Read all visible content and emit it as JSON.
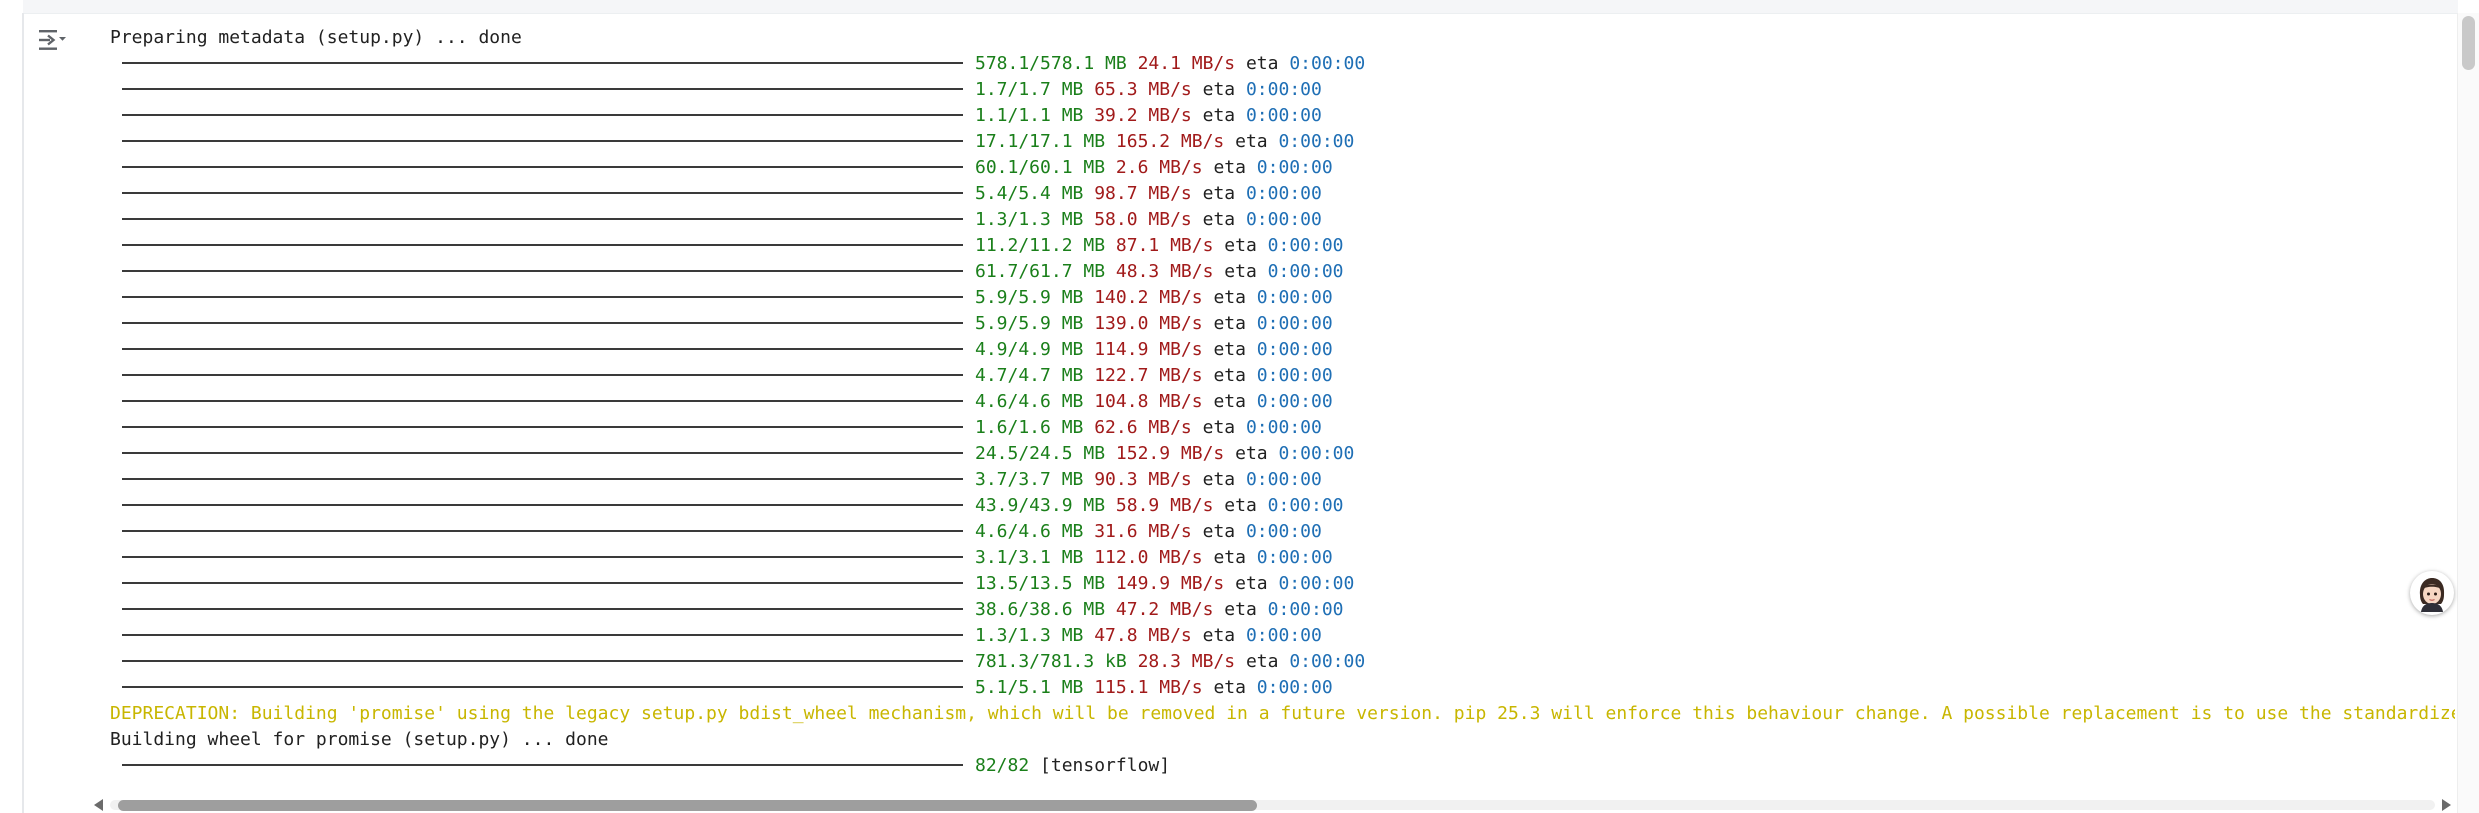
{
  "colors": {
    "progress_bar": "#3a3a3a",
    "size": "#1a7f1a",
    "speed": "#a11a1a",
    "eta": "#1f6fb5",
    "warning": "#c8b600",
    "text": "#212121"
  },
  "toolbar": {
    "output_toggle_icon": "output-toggle-icon",
    "avatar_icon": "assistant-avatar-icon"
  },
  "output": {
    "preparing_line": "Preparing metadata (setup.py) ... done",
    "downloads": [
      {
        "size": "578.1/578.1 MB",
        "speed": "24.1 MB/s",
        "eta_label": "eta",
        "eta": "0:00:00"
      },
      {
        "size": "1.7/1.7 MB",
        "speed": "65.3 MB/s",
        "eta_label": "eta",
        "eta": "0:00:00"
      },
      {
        "size": "1.1/1.1 MB",
        "speed": "39.2 MB/s",
        "eta_label": "eta",
        "eta": "0:00:00"
      },
      {
        "size": "17.1/17.1 MB",
        "speed": "165.2 MB/s",
        "eta_label": "eta",
        "eta": "0:00:00"
      },
      {
        "size": "60.1/60.1 MB",
        "speed": "2.6 MB/s",
        "eta_label": "eta",
        "eta": "0:00:00"
      },
      {
        "size": "5.4/5.4 MB",
        "speed": "98.7 MB/s",
        "eta_label": "eta",
        "eta": "0:00:00"
      },
      {
        "size": "1.3/1.3 MB",
        "speed": "58.0 MB/s",
        "eta_label": "eta",
        "eta": "0:00:00"
      },
      {
        "size": "11.2/11.2 MB",
        "speed": "87.1 MB/s",
        "eta_label": "eta",
        "eta": "0:00:00"
      },
      {
        "size": "61.7/61.7 MB",
        "speed": "48.3 MB/s",
        "eta_label": "eta",
        "eta": "0:00:00"
      },
      {
        "size": "5.9/5.9 MB",
        "speed": "140.2 MB/s",
        "eta_label": "eta",
        "eta": "0:00:00"
      },
      {
        "size": "5.9/5.9 MB",
        "speed": "139.0 MB/s",
        "eta_label": "eta",
        "eta": "0:00:00"
      },
      {
        "size": "4.9/4.9 MB",
        "speed": "114.9 MB/s",
        "eta_label": "eta",
        "eta": "0:00:00"
      },
      {
        "size": "4.7/4.7 MB",
        "speed": "122.7 MB/s",
        "eta_label": "eta",
        "eta": "0:00:00"
      },
      {
        "size": "4.6/4.6 MB",
        "speed": "104.8 MB/s",
        "eta_label": "eta",
        "eta": "0:00:00"
      },
      {
        "size": "1.6/1.6 MB",
        "speed": "62.6 MB/s",
        "eta_label": "eta",
        "eta": "0:00:00"
      },
      {
        "size": "24.5/24.5 MB",
        "speed": "152.9 MB/s",
        "eta_label": "eta",
        "eta": "0:00:00"
      },
      {
        "size": "3.7/3.7 MB",
        "speed": "90.3 MB/s",
        "eta_label": "eta",
        "eta": "0:00:00"
      },
      {
        "size": "43.9/43.9 MB",
        "speed": "58.9 MB/s",
        "eta_label": "eta",
        "eta": "0:00:00"
      },
      {
        "size": "4.6/4.6 MB",
        "speed": "31.6 MB/s",
        "eta_label": "eta",
        "eta": "0:00:00"
      },
      {
        "size": "3.1/3.1 MB",
        "speed": "112.0 MB/s",
        "eta_label": "eta",
        "eta": "0:00:00"
      },
      {
        "size": "13.5/13.5 MB",
        "speed": "149.9 MB/s",
        "eta_label": "eta",
        "eta": "0:00:00"
      },
      {
        "size": "38.6/38.6 MB",
        "speed": "47.2 MB/s",
        "eta_label": "eta",
        "eta": "0:00:00"
      },
      {
        "size": "1.3/1.3 MB",
        "speed": "47.8 MB/s",
        "eta_label": "eta",
        "eta": "0:00:00"
      },
      {
        "size": "781.3/781.3 kB",
        "speed": "28.3 MB/s",
        "eta_label": "eta",
        "eta": "0:00:00"
      },
      {
        "size": "5.1/5.1 MB",
        "speed": "115.1 MB/s",
        "eta_label": "eta",
        "eta": "0:00:00"
      }
    ],
    "deprecation_line": "DEPRECATION: Building 'promise' using the legacy setup.py bdist_wheel mechanism, which will be removed in a future version. pip 25.3 will enforce this behaviour change. A possible replacement is to use the standardized buil",
    "building_line": "Building wheel for promise (setup.py) ... done",
    "final_progress": {
      "count": "82/82",
      "package": "[tensorflow]"
    }
  },
  "scrollbar": {
    "horizontal_thumb_fraction": 0.49
  }
}
